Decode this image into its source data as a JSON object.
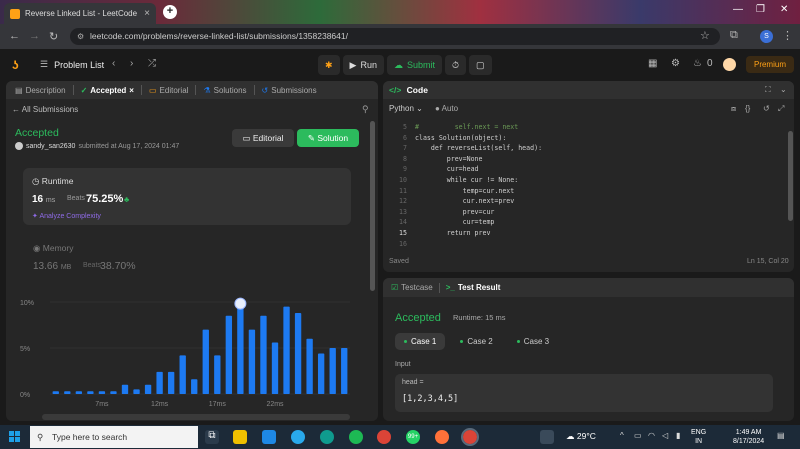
{
  "browser": {
    "tab_title": "Reverse Linked List - LeetCode",
    "tab_close": "×",
    "new_tab": "+",
    "url": "leetcode.com/problems/reverse-linked-list/submissions/1358238641/",
    "profile_initial": "S"
  },
  "header": {
    "problem_list": "Problem List",
    "run": "Run",
    "submit": "Submit",
    "points": "0",
    "premium": "Premium"
  },
  "left_tabs": [
    {
      "label": "Description",
      "icon": "description-icon"
    },
    {
      "label": "Accepted",
      "icon": "accepted-icon",
      "active": true
    },
    {
      "label": "Editorial",
      "icon": "editorial-icon"
    },
    {
      "label": "Solutions",
      "icon": "solutions-icon"
    },
    {
      "label": "Submissions",
      "icon": "submissions-icon"
    }
  ],
  "submission": {
    "back": "All Submissions",
    "status": "Accepted",
    "user": "sandy_san2630",
    "submitted_text": "submitted at Aug 17, 2024 01:47",
    "editorial_btn": "Editorial",
    "solution_btn": "Solution",
    "runtime_label": "Runtime",
    "runtime_value": "16",
    "runtime_unit": "ms",
    "beats_label": "Beats",
    "runtime_beats": "75.25%",
    "analyze": "Analyze Complexity",
    "memory_label": "Memory",
    "memory_value": "13.66",
    "memory_unit": "MB",
    "memory_beats": "38.70%"
  },
  "chart_data": {
    "type": "bar",
    "title": "",
    "xlabel": "",
    "ylabel": "",
    "ylim": [
      0,
      10
    ],
    "yticks": [
      "10%",
      "5%",
      "0%"
    ],
    "xticks": [
      "7ms",
      "12ms",
      "17ms",
      "22ms"
    ],
    "bar_color": "#1d7af2",
    "values": [
      0.3,
      0.3,
      0.3,
      0.3,
      0.3,
      0.3,
      1.0,
      0.5,
      1.0,
      2.4,
      2.4,
      4.2,
      1.6,
      7.0,
      4.2,
      8.5,
      9.5,
      7.0,
      8.5,
      5.6,
      9.5,
      8.8,
      6.0,
      4.4,
      5.0,
      5.0
    ],
    "highlight_index": 16
  },
  "code": {
    "title": "Code",
    "language": "Python",
    "auto": "Auto",
    "lines": [
      {
        "n": "5",
        "t": "#         self.next = next"
      },
      {
        "n": "6",
        "t": "class Solution(object):"
      },
      {
        "n": "7",
        "t": "    def reverseList(self, head):"
      },
      {
        "n": "8",
        "t": "        prev=None"
      },
      {
        "n": "9",
        "t": "        cur=head"
      },
      {
        "n": "10",
        "t": "        while cur != None:"
      },
      {
        "n": "11",
        "t": "            temp=cur.next"
      },
      {
        "n": "12",
        "t": "            cur.next=prev"
      },
      {
        "n": "13",
        "t": "            prev=cur"
      },
      {
        "n": "14",
        "t": "            cur=temp"
      },
      {
        "n": "15",
        "t": "        return prev"
      },
      {
        "n": "16",
        "t": ""
      }
    ],
    "saved": "Saved",
    "position": "Ln 15, Col 20"
  },
  "test": {
    "tab_testcase": "Testcase",
    "tab_result": "Test Result",
    "status": "Accepted",
    "runtime": "Runtime: 15 ms",
    "cases": [
      "Case 1",
      "Case 2",
      "Case 3"
    ],
    "input_label": "Input",
    "var": "head =",
    "value": "[1,2,3,4,5]"
  },
  "taskbar": {
    "search_placeholder": "Type here to search",
    "badge": "99+",
    "temperature": "29°C",
    "lang_top": "ENG",
    "lang_bottom": "IN",
    "time": "1:49 AM",
    "date": "8/17/2024"
  }
}
